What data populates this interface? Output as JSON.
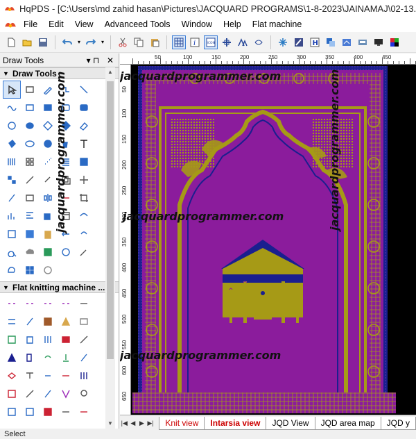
{
  "app": {
    "title": "HqPDS - [C:\\Users\\md zahid hasan\\Pictures\\JACQUARD PROGRAMS\\1-8-2023\\JAINAMAJ\\02-13.pds]"
  },
  "menu": {
    "items": [
      "File",
      "Edit",
      "View",
      "Advanceed Tools",
      "Window",
      "Help",
      "Flat machine"
    ]
  },
  "toolbar": {
    "icons": [
      "new-icon",
      "open-icon",
      "save-icon",
      "undo-icon",
      "redo-icon",
      "cut-icon",
      "copy-icon",
      "paste-icon",
      "grid-icon",
      "info-icon",
      "icon-view-icon",
      "center-icon",
      "flip-icon",
      "loop-icon",
      "star-icon",
      "edit-icon",
      "h-icon",
      "layers-icon",
      "export-icon",
      "machine-icon",
      "display-icon",
      "palette-icon"
    ]
  },
  "panel": {
    "title": "Draw Tools",
    "pin": "▾ ⊓",
    "close": "✕",
    "sections": [
      {
        "label": "Draw Tools",
        "arrow": "▼"
      },
      {
        "label": "Flat knitting machine ...",
        "arrow": "▼"
      }
    ]
  },
  "ruler": {
    "h": [
      "50",
      "100",
      "150",
      "200",
      "250",
      "300",
      "350",
      "400",
      "450"
    ],
    "v": [
      "50",
      "100",
      "150",
      "200",
      "250",
      "300",
      "350",
      "400",
      "450",
      "500",
      "550",
      "600",
      "650",
      "700"
    ]
  },
  "tabs": [
    "Knit view",
    "Intarsia view",
    "JQD View",
    "JQD area map",
    "JQD y"
  ],
  "tab_nav": [
    "|◀",
    "◀",
    "▶",
    "▶|"
  ],
  "status": "Select",
  "watermark": "jacquardprogrammer.com",
  "colors": {
    "purple": "#8b1c9c",
    "olive": "#a69a16",
    "navy": "#1a1f8f",
    "black": "#000000"
  }
}
